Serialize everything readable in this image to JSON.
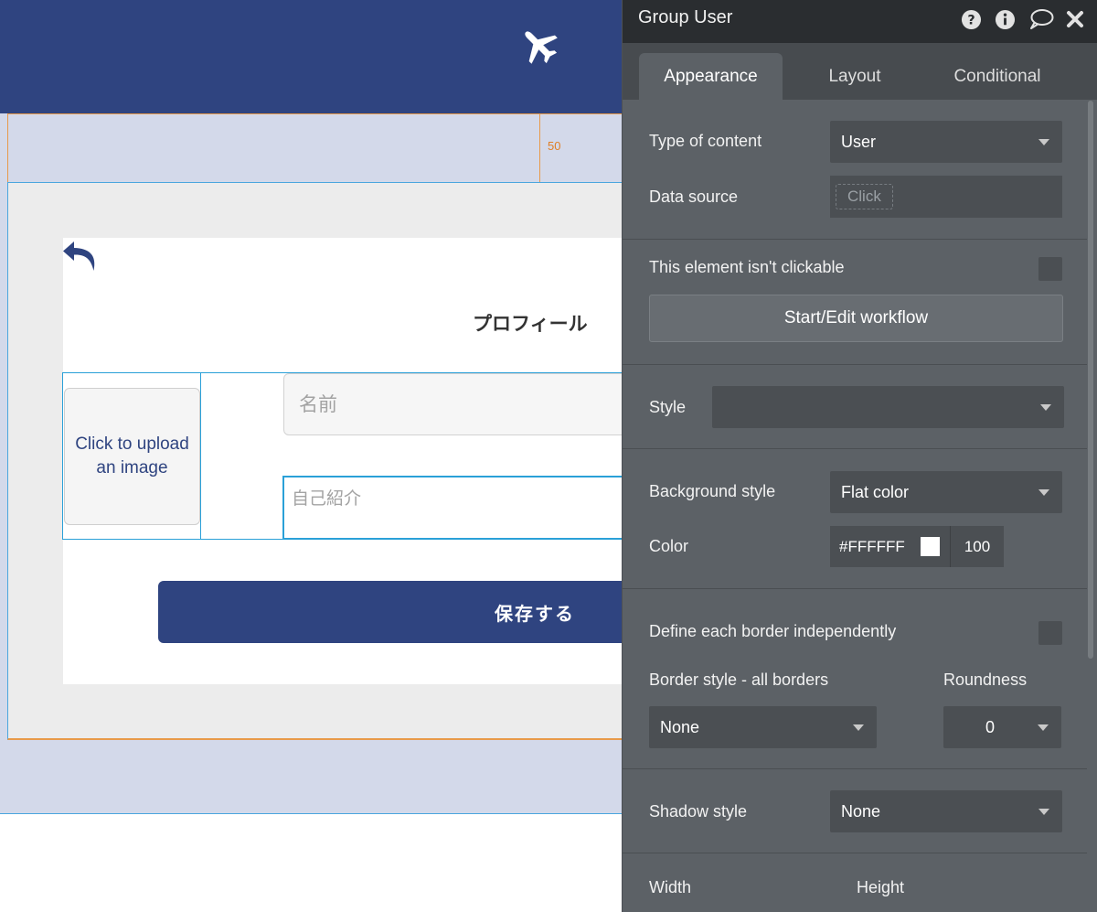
{
  "canvas": {
    "guide_value": "50",
    "page_title": "プロフィール",
    "uploader_text": "Click to upload an image",
    "name_placeholder": "名前",
    "bio_placeholder": "自己紹介",
    "save_label": "保存する",
    "icons": {
      "logo": "airplane-icon",
      "back": "back-arrow-icon"
    }
  },
  "panel": {
    "title": "Group User",
    "header_icons": [
      "help-icon",
      "info-icon",
      "comment-icon",
      "close-icon"
    ],
    "tabs": [
      {
        "label": "Appearance",
        "active": true
      },
      {
        "label": "Layout",
        "active": false
      },
      {
        "label": "Conditional",
        "active": false
      }
    ],
    "type_of_content": {
      "label": "Type of content",
      "value": "User"
    },
    "data_source": {
      "label": "Data source",
      "placeholder": "Click"
    },
    "not_clickable": {
      "label": "This element isn't clickable",
      "checked": false
    },
    "workflow_button": "Start/Edit workflow",
    "style": {
      "label": "Style",
      "value": ""
    },
    "background_style": {
      "label": "Background style",
      "value": "Flat color"
    },
    "color": {
      "label": "Color",
      "hex": "#FFFFFF",
      "opacity": "100"
    },
    "define_borders": {
      "label": "Define each border independently",
      "checked": false
    },
    "border_style": {
      "label": "Border style - all borders",
      "value": "None"
    },
    "roundness": {
      "label": "Roundness",
      "value": "0"
    },
    "shadow_style": {
      "label": "Shadow style",
      "value": "None"
    },
    "width": {
      "label": "Width"
    },
    "height": {
      "label": "Height"
    }
  },
  "colors": {
    "header": "#2f4480",
    "page_band": "#d3d9ea",
    "panel_bg": "#5c6166",
    "panel_title_bg": "#2a2d30",
    "selection": "#2aa0d8",
    "guide": "#e89a4a"
  }
}
